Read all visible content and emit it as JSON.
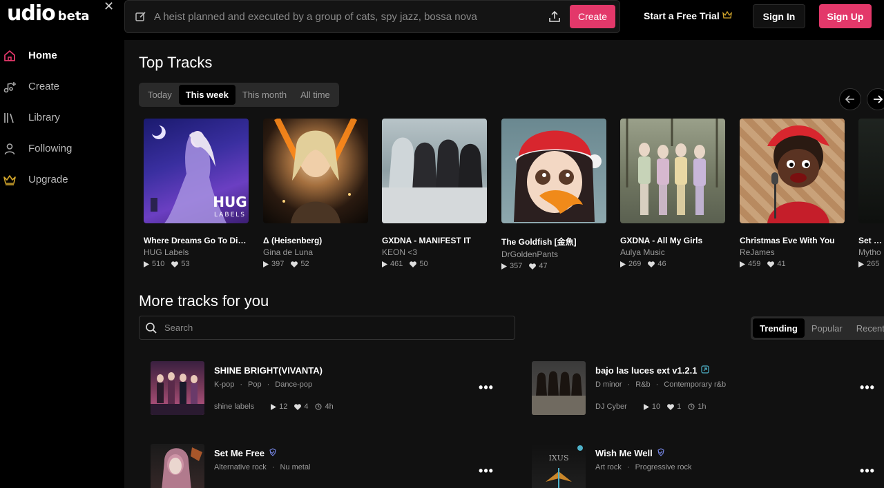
{
  "brand": {
    "name": "udio",
    "tag": "beta"
  },
  "sidebar": {
    "items": [
      {
        "label": "Home",
        "icon": "home-icon"
      },
      {
        "label": "Create",
        "icon": "music-plus-icon"
      },
      {
        "label": "Library",
        "icon": "library-icon"
      },
      {
        "label": "Following",
        "icon": "user-icon"
      },
      {
        "label": "Upgrade",
        "icon": "crown-icon"
      }
    ]
  },
  "topbar": {
    "prompt_placeholder": "A heist planned and executed by a group of cats, spy jazz, bossa nova",
    "create_label": "Create",
    "trial_label": "Start a Free Trial",
    "signin_label": "Sign In",
    "signup_label": "Sign Up"
  },
  "top_tracks": {
    "title": "Top Tracks",
    "tabs": [
      "Today",
      "This week",
      "This month",
      "All time"
    ],
    "active_tab": "This week",
    "tracks": [
      {
        "title": "Where Dreams Go To Die ...",
        "artist": "HUG Labels",
        "plays": "510",
        "likes": "53",
        "cover_text": "HUG\nLABELS"
      },
      {
        "title": "Δ (Heisenberg)",
        "artist": "Gina de Luna",
        "plays": "397",
        "likes": "52"
      },
      {
        "title": "GXDNA - MANIFEST IT",
        "artist": "KEON <3",
        "plays": "461",
        "likes": "50"
      },
      {
        "title": "The Goldfish [金魚]",
        "artist": "DrGoldenPants",
        "plays": "357",
        "likes": "47"
      },
      {
        "title": "GXDNA - All My Girls",
        "artist": "Aulya Music",
        "plays": "269",
        "likes": "46"
      },
      {
        "title": "Christmas Eve With You",
        "artist": "ReJames",
        "plays": "459",
        "likes": "41"
      },
      {
        "title": "Set Me",
        "artist": "Mytho",
        "plays": "265",
        "likes": ""
      }
    ]
  },
  "more_tracks": {
    "title": "More tracks for you",
    "search_placeholder": "Search",
    "sort_tabs": [
      "Trending",
      "Popular",
      "Recent"
    ],
    "active_sort": "Trending",
    "items": [
      {
        "title": "SHINE BRIGHT(VIVANTA)",
        "tags": [
          "K-pop",
          "Pop",
          "Dance-pop"
        ],
        "artist": "shine labels",
        "plays": "12",
        "likes": "4",
        "age": "4h",
        "badge": ""
      },
      {
        "title": "bajo las luces ext v1.2.1",
        "tags": [
          "D minor",
          "R&b",
          "Contemporary r&b"
        ],
        "artist": "DJ Cyber",
        "plays": "10",
        "likes": "1",
        "age": "1h",
        "badge": "extend"
      },
      {
        "title": "Set Me Free",
        "tags": [
          "Alternative rock",
          "Nu metal"
        ],
        "artist": "",
        "plays": "",
        "likes": "",
        "age": "",
        "badge": "verified"
      },
      {
        "title": "Wish Me Well",
        "tags": [
          "Art rock",
          "Progressive rock"
        ],
        "artist": "",
        "plays": "",
        "likes": "",
        "age": "",
        "badge": "verified"
      }
    ]
  },
  "colors": {
    "accent": "#e3386a",
    "crown": "#d4a72c",
    "bg": "#111111"
  }
}
